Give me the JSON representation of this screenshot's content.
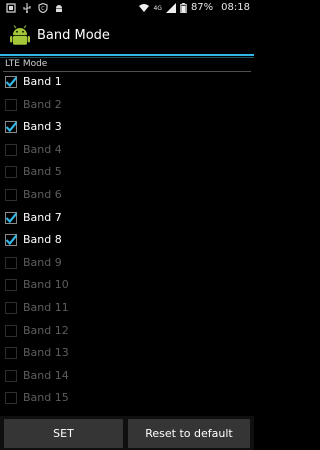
{
  "status_bar": {
    "network_type": "4G",
    "battery_percent": "87%",
    "time": "08:18",
    "left_icons": [
      "notification-icon",
      "usb-icon",
      "shield-icon",
      "android-icon"
    ],
    "right_icons": [
      "wifi-icon",
      "signal-icon",
      "battery-icon"
    ]
  },
  "action_bar": {
    "title": "Band Mode",
    "accent_color": "#33b5e5"
  },
  "section": {
    "label": "LTE Mode"
  },
  "bands": [
    {
      "label": "Band 1",
      "checked": true
    },
    {
      "label": "Band 2",
      "checked": false
    },
    {
      "label": "Band 3",
      "checked": true
    },
    {
      "label": "Band 4",
      "checked": false
    },
    {
      "label": "Band 5",
      "checked": false
    },
    {
      "label": "Band 6",
      "checked": false
    },
    {
      "label": "Band 7",
      "checked": true
    },
    {
      "label": "Band 8",
      "checked": true
    },
    {
      "label": "Band 9",
      "checked": false
    },
    {
      "label": "Band 10",
      "checked": false
    },
    {
      "label": "Band 11",
      "checked": false
    },
    {
      "label": "Band 12",
      "checked": false
    },
    {
      "label": "Band 13",
      "checked": false
    },
    {
      "label": "Band 14",
      "checked": false
    },
    {
      "label": "Band 15",
      "checked": false
    }
  ],
  "buttons": {
    "set_label": "SET",
    "reset_label": "Reset to default"
  }
}
